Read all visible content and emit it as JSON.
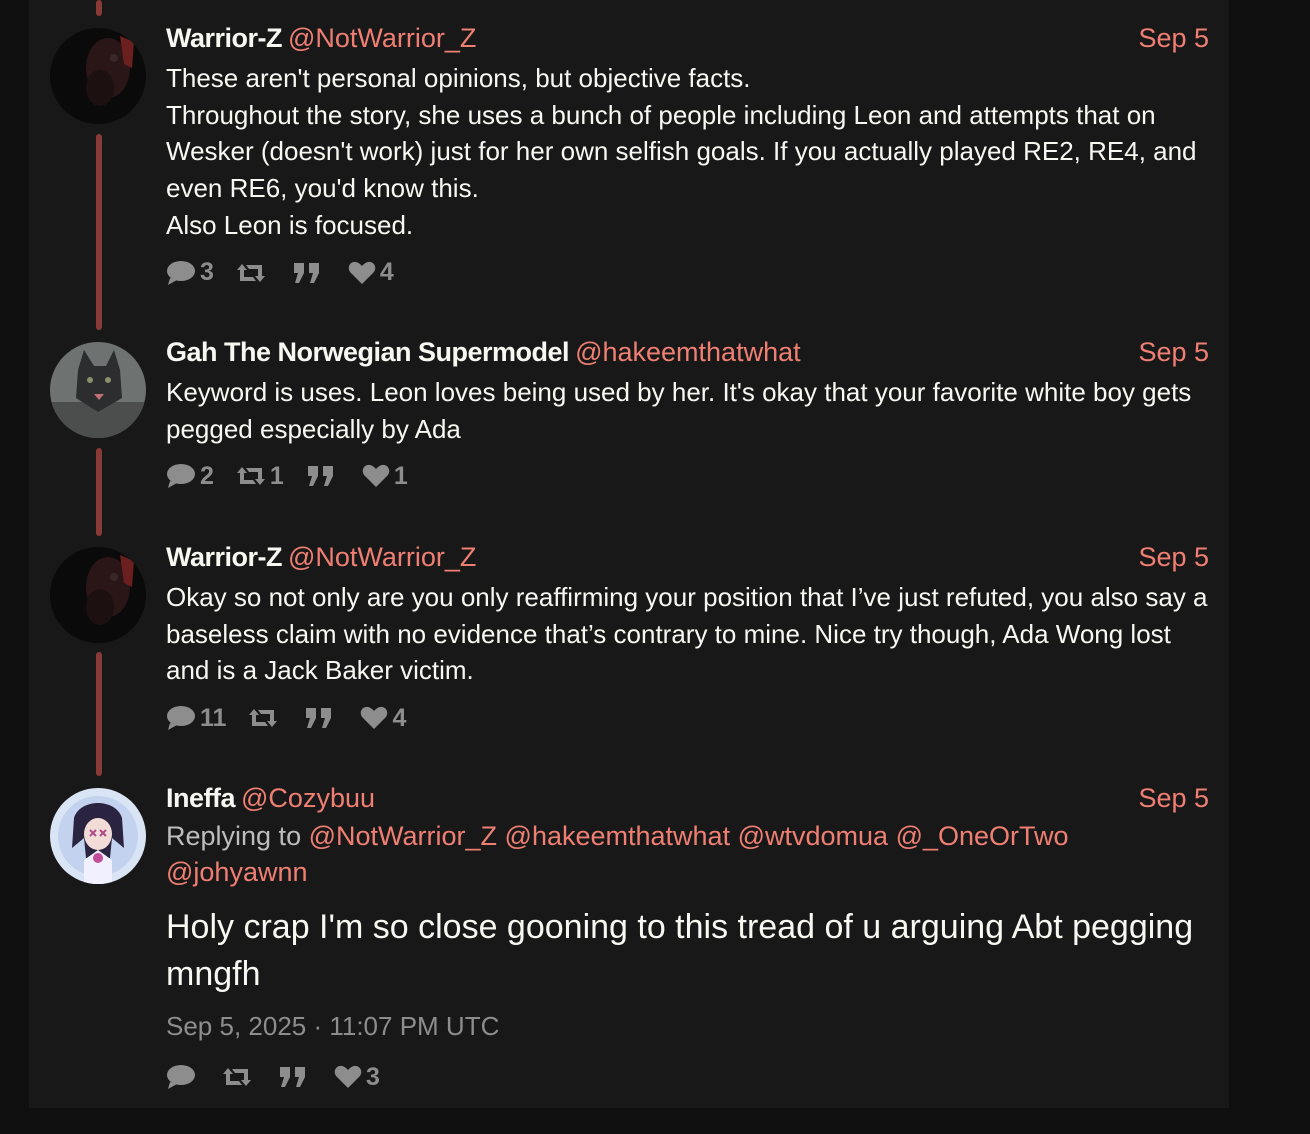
{
  "colors": {
    "background": "#0f0f0f",
    "panel": "#181818",
    "accent": "#f07f73",
    "thread_line": "#8a3a36",
    "muted": "#8d8d8d",
    "text": "#f8f8f2"
  },
  "tweets": [
    {
      "fullname": "Warrior-Z",
      "username": "@NotWarrior_Z",
      "date": "Sep 5",
      "body": [
        "These aren't personal opinions, but objective facts.",
        "Throughout the story, she uses a bunch of people including Leon and attempts that on Wesker (doesn't work) just for her own selfish goals. If you actually played RE2, RE4, and even RE6, you'd know this.",
        "Also Leon is focused."
      ],
      "stats": {
        "replies": "3",
        "retweets": "",
        "quotes": "",
        "likes": "4"
      }
    },
    {
      "fullname": "Gah The Norwegian Supermodel",
      "username": "@hakeemthatwhat",
      "date": "Sep 5",
      "body": [
        "Keyword is uses. Leon loves being used by her. It's okay that your favorite white boy gets pegged especially by Ada"
      ],
      "stats": {
        "replies": "2",
        "retweets": "1",
        "quotes": "",
        "likes": "1"
      }
    },
    {
      "fullname": "Warrior-Z",
      "username": "@NotWarrior_Z",
      "date": "Sep 5",
      "body": [
        "Okay so not only are you only reaffirming your position that I’ve just refuted, you also say a baseless claim with no evidence that’s contrary to mine. Nice try though, Ada Wong lost and is a Jack Baker victim."
      ],
      "stats": {
        "replies": "11",
        "retweets": "",
        "quotes": "",
        "likes": "4"
      }
    },
    {
      "fullname": "Ineffa",
      "username": "@Cozybuu",
      "date": "Sep 5",
      "replying_label": "Replying to",
      "replying_to": [
        "@NotWarrior_Z",
        "@hakeemthatwhat",
        "@wtvdomua",
        "@_OneOrTwo",
        "@johyawnn"
      ],
      "body": "Holy crap I'm so close gooning to this tread of u arguing Abt pegging mngfh",
      "timestamp": "Sep 5, 2025 · 11:07 PM UTC",
      "stats": {
        "replies": "",
        "retweets": "",
        "quotes": "",
        "likes": "3"
      }
    }
  ]
}
